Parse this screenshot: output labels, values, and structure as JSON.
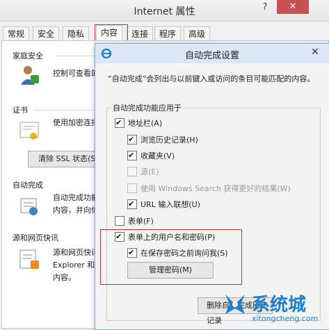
{
  "outer_window": {
    "title": "Internet 属性",
    "help": "?",
    "close": "✕",
    "tabs": [
      "常规",
      "安全",
      "隐私",
      "内容",
      "连接",
      "程序",
      "高级"
    ],
    "active_tab": "内容",
    "sections": {
      "family": {
        "heading": "家庭安全",
        "text": "控制可查看的"
      },
      "cert": {
        "heading": "证书",
        "text": "使用加密连接",
        "ssl_button": "清除 SSL 状态(S)"
      },
      "autocomplete": {
        "heading": "自动完成",
        "text_line1": "自动完成功能",
        "text_line2": "内容，并向你"
      },
      "feeds": {
        "heading": "源和网页快讯",
        "text_line1": "源和网页快讯",
        "text_line2": "Explorer 和",
        "text_line3": "内容。"
      }
    }
  },
  "dialog": {
    "title": "自动完成设置",
    "close": "✕",
    "description": "“自动完成”会列出与以前键入或访问的条目可能匹配的内容。",
    "group_label": "自动完成功能应用于",
    "options": [
      {
        "label": "地址栏(A)",
        "checked": true,
        "disabled": false,
        "indent": 0
      },
      {
        "label": "浏览历史记录(H)",
        "checked": true,
        "disabled": false,
        "indent": 1
      },
      {
        "label": "收藏夹(V)",
        "checked": true,
        "disabled": false,
        "indent": 1
      },
      {
        "label": "源(E)",
        "checked": false,
        "disabled": true,
        "indent": 1
      },
      {
        "label": "使用 Windows Search 获得更好的结果(W)",
        "checked": false,
        "disabled": true,
        "indent": 1
      },
      {
        "label": "URL 输入联想(U)",
        "checked": true,
        "disabled": false,
        "indent": 1
      },
      {
        "label": "表单(F)",
        "checked": false,
        "disabled": false,
        "indent": 0
      },
      {
        "label": "表单上的用户名和密码(P)",
        "checked": true,
        "disabled": false,
        "indent": 0
      },
      {
        "label": "在保存密码之前询问我(S)",
        "checked": true,
        "disabled": false,
        "indent": 1
      }
    ],
    "manage_button": "管理密码(M)",
    "delete_button": "删除自动完成历史记录"
  },
  "watermark": {
    "brand": "系统城",
    "url": "xitongcheng.com"
  },
  "colors": {
    "highlight_red": "#c0383a",
    "title_blue": "#dbe7f4",
    "watermark_blue": "#1c7fd0"
  }
}
